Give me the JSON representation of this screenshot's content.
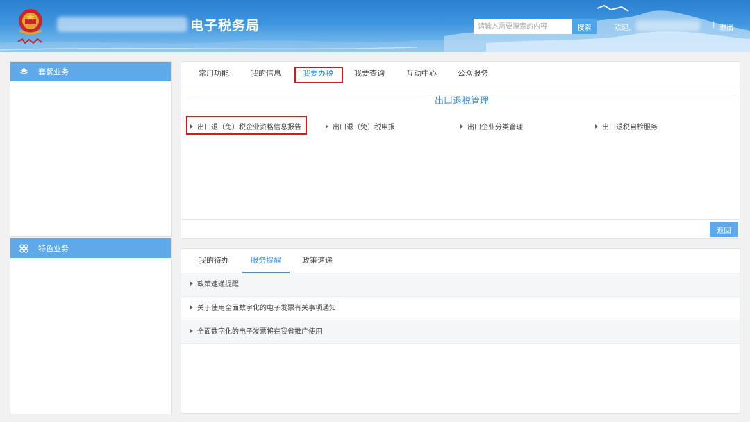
{
  "header": {
    "title": "电子税务局",
    "search_placeholder": "请输入需要搜索的内容",
    "search_button": "搜索",
    "welcome": "欢迎,",
    "separator": "|",
    "logout": "退出"
  },
  "sidebar": {
    "package_business": "套餐业务",
    "special_business": "特色业务"
  },
  "main_tabs": [
    "常用功能",
    "我的信息",
    "我要办税",
    "我要查询",
    "互动中心",
    "公众服务"
  ],
  "export_refund": {
    "section_title": "出口退税管理",
    "items": [
      "出口退（免）税企业资格信息报告",
      "出口退（免）税申报",
      "出口企业分类管理",
      "出口退税自检服务"
    ],
    "back_button": "返回"
  },
  "bottom_tabs": [
    "我的待办",
    "服务提醒",
    "政策速递"
  ],
  "notices": [
    "政策速递提醒",
    "关于使用全面数字化的电子发票有关事项通知",
    "全面数字化的电子发票将在我省推广使用"
  ],
  "colors": {
    "accent": "#3b8fd9",
    "sidebar_header": "#5fa9e8",
    "highlight_box": "#d6171b"
  }
}
